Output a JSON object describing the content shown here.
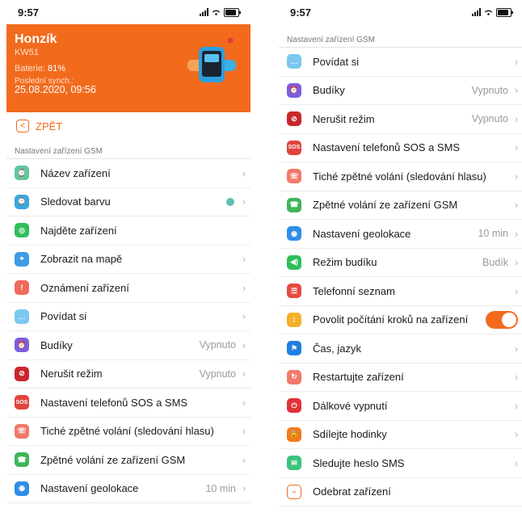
{
  "left": {
    "time": "9:57",
    "device": {
      "name": "Honzík",
      "model": "KW51",
      "battery_label": "Baterie:",
      "battery_value": "81%",
      "sync_label": "Poslední synch.:",
      "sync_value": "25.08.2020, 09:56"
    },
    "back_label": "ZPĚT",
    "section": "Nastavení zařízení GSM",
    "rows": [
      {
        "label": "Název zařízení",
        "value": "",
        "icon": "watch-name-icon",
        "color": "#5fc6a0",
        "chevron": true
      },
      {
        "label": "Sledovat barvu",
        "value": "",
        "icon": "watch-color-icon",
        "color": "#3aa7e0",
        "chevron": true,
        "dot": true
      },
      {
        "label": "Najděte zařízení",
        "value": "",
        "icon": "find-device-icon",
        "color": "#2fbf5a",
        "chevron": false
      },
      {
        "label": "Zobrazit na mapě",
        "value": "",
        "icon": "map-icon",
        "color": "#3d9be6",
        "chevron": true
      },
      {
        "label": "Oznámení zařízení",
        "value": "",
        "icon": "notification-icon",
        "color": "#ef6a5a",
        "chevron": true
      },
      {
        "label": "Povídat si",
        "value": "",
        "icon": "chat-icon",
        "color": "#7bc8f0",
        "chevron": true
      },
      {
        "label": "Budíky",
        "value": "Vypnuto",
        "icon": "alarm-icon",
        "color": "#7a5fe0",
        "chevron": true
      },
      {
        "label": "Nerušit režim",
        "value": "Vypnuto",
        "icon": "do-not-disturb-icon",
        "color": "#c9262c",
        "chevron": true
      },
      {
        "label": "Nastavení telefonů SOS a SMS",
        "value": "",
        "icon": "sos-icon",
        "color": "#e1433d",
        "chevron": true
      },
      {
        "label": "Tiché zpětné volání (sledování hlasu)",
        "value": "",
        "icon": "silent-callback-icon",
        "color": "#f07a6a",
        "chevron": true
      },
      {
        "label": "Zpětné volání ze zařízení GSM",
        "value": "",
        "icon": "callback-icon",
        "color": "#3fb55a",
        "chevron": true
      },
      {
        "label": "Nastavení geolokace",
        "value": "10 min",
        "icon": "geolocation-icon",
        "color": "#2f8fe6",
        "chevron": true
      }
    ]
  },
  "right": {
    "time": "9:57",
    "section": "Nastavení zařízení GSM",
    "rows": [
      {
        "label": "Povídat si",
        "value": "",
        "icon": "chat-icon",
        "color": "#7bc8f0",
        "chevron": true
      },
      {
        "label": "Budíky",
        "value": "Vypnuto",
        "icon": "alarm-icon",
        "color": "#7a5fe0",
        "chevron": true
      },
      {
        "label": "Nerušit režim",
        "value": "Vypnuto",
        "icon": "do-not-disturb-icon",
        "color": "#c9262c",
        "chevron": true
      },
      {
        "label": "Nastavení telefonů SOS a SMS",
        "value": "",
        "icon": "sos-icon",
        "color": "#e1433d",
        "chevron": true
      },
      {
        "label": "Tiché zpětné volání (sledování hlasu)",
        "value": "",
        "icon": "silent-callback-icon",
        "color": "#f07a6a",
        "chevron": true
      },
      {
        "label": "Zpětné volání ze zařízení GSM",
        "value": "",
        "icon": "callback-icon",
        "color": "#3fb55a",
        "chevron": true
      },
      {
        "label": "Nastavení geolokace",
        "value": "10 min",
        "icon": "geolocation-icon",
        "color": "#2f8fe6",
        "chevron": true
      },
      {
        "label": "Režim budíku",
        "value": "Budík",
        "icon": "alarm-mode-icon",
        "color": "#2fbf5a",
        "chevron": true
      },
      {
        "label": "Telefonní seznam",
        "value": "",
        "icon": "phonebook-icon",
        "color": "#e84a3f",
        "chevron": true
      },
      {
        "label": "Povolit počítání kroků na zařízení",
        "value": "",
        "icon": "steps-icon",
        "color": "#f5b02a",
        "chevron": false,
        "toggle": true
      },
      {
        "label": "Čas, jazyk",
        "value": "",
        "icon": "time-language-icon",
        "color": "#1f7fe0",
        "chevron": true
      },
      {
        "label": "Restartujte zařízení",
        "value": "",
        "icon": "restart-icon",
        "color": "#f07a6a",
        "chevron": true
      },
      {
        "label": "Dálkové vypnutí",
        "value": "",
        "icon": "power-off-icon",
        "color": "#e0323a",
        "chevron": true
      },
      {
        "label": "Sdílejte hodinky",
        "value": "",
        "icon": "share-lock-icon",
        "color": "#f27a1d",
        "chevron": true
      },
      {
        "label": "Sledujte heslo SMS",
        "value": "",
        "icon": "sms-password-icon",
        "color": "#3cc47a",
        "chevron": true
      },
      {
        "label": "Odebrat zařízení",
        "value": "",
        "icon": "remove-device-icon",
        "color": "#f26b1d",
        "chevron": false,
        "outline": true
      }
    ]
  }
}
